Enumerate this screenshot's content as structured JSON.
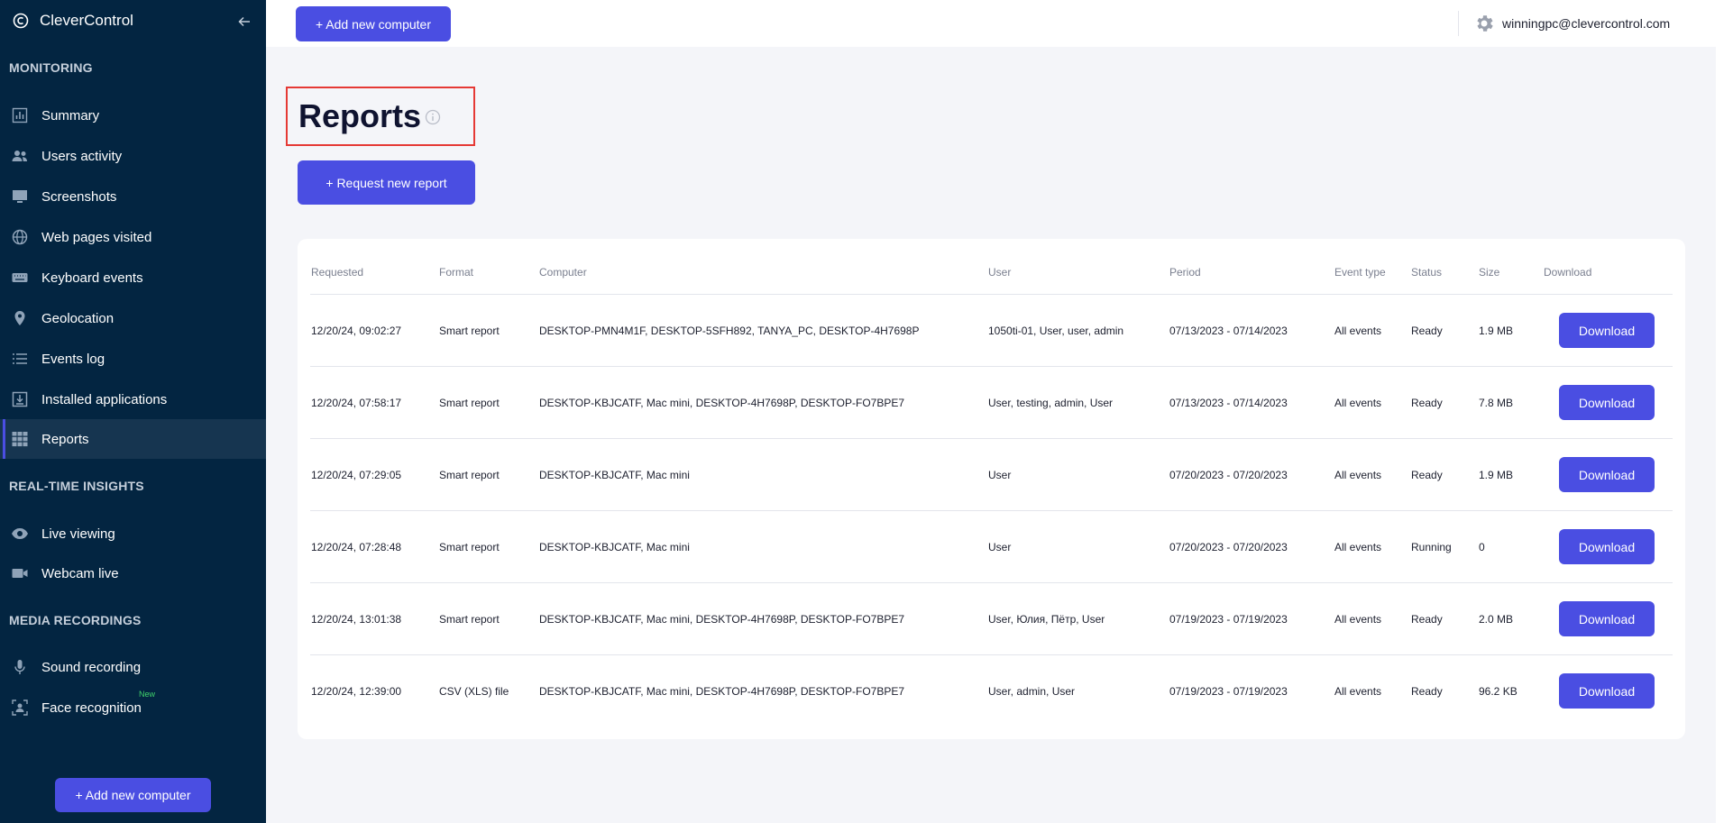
{
  "app": {
    "name": "CleverControl",
    "account_email": "winningpc@clevercontrol.com"
  },
  "sidebar": {
    "sections": {
      "monitoring": "MONITORING",
      "realtime": "REAL-TIME INSIGHTS",
      "media": "MEDIA RECORDINGS"
    },
    "items": [
      {
        "label": "Summary",
        "icon": "bar-chart-icon"
      },
      {
        "label": "Users activity",
        "icon": "users-icon"
      },
      {
        "label": "Screenshots",
        "icon": "monitor-icon"
      },
      {
        "label": "Web pages visited",
        "icon": "globe-icon"
      },
      {
        "label": "Keyboard events",
        "icon": "keyboard-icon"
      },
      {
        "label": "Geolocation",
        "icon": "map-pin-icon"
      },
      {
        "label": "Events log",
        "icon": "list-icon"
      },
      {
        "label": "Installed applications",
        "icon": "download-box-icon"
      },
      {
        "label": "Reports",
        "icon": "grid-icon",
        "active": true
      },
      {
        "label": "Live viewing",
        "icon": "eye-icon"
      },
      {
        "label": "Webcam live",
        "icon": "video-camera-icon"
      },
      {
        "label": "Sound recording",
        "icon": "microphone-icon"
      },
      {
        "label": "Face recognition",
        "icon": "face-scan-icon",
        "badge": "New"
      }
    ],
    "add_button": "+ Add new computer"
  },
  "topbar": {
    "add_button": "+ Add new computer"
  },
  "page": {
    "title": "Reports",
    "request_button": "+ Request new report"
  },
  "table": {
    "headers": [
      "Requested",
      "Format",
      "Computer",
      "User",
      "Period",
      "Event type",
      "Status",
      "Size",
      "Download"
    ],
    "download_label": "Download",
    "rows": [
      {
        "requested": "12/20/24, 09:02:27",
        "format": "Smart report",
        "computer": "DESKTOP-PMN4M1F, DESKTOP-5SFH892, TANYA_PC, DESKTOP-4H7698P",
        "user": "1050ti-01, User, user, admin",
        "period": "07/13/2023 - 07/14/2023",
        "event_type": "All events",
        "status": "Ready",
        "size": "1.9 MB"
      },
      {
        "requested": "12/20/24, 07:58:17",
        "format": "Smart report",
        "computer": "DESKTOP-KBJCATF, Mac mini, DESKTOP-4H7698P, DESKTOP-FO7BPE7",
        "user": "User, testing, admin, User",
        "period": "07/13/2023 - 07/14/2023",
        "event_type": "All events",
        "status": "Ready",
        "size": "7.8 MB"
      },
      {
        "requested": "12/20/24, 07:29:05",
        "format": "Smart report",
        "computer": "DESKTOP-KBJCATF, Mac mini",
        "user": "User",
        "period": "07/20/2023 - 07/20/2023",
        "event_type": "All events",
        "status": "Ready",
        "size": "1.9 MB"
      },
      {
        "requested": "12/20/24, 07:28:48",
        "format": "Smart report",
        "computer": "DESKTOP-KBJCATF, Mac mini",
        "user": "User",
        "period": "07/20/2023 - 07/20/2023",
        "event_type": "All events",
        "status": "Running",
        "size": "0"
      },
      {
        "requested": "12/20/24, 13:01:38",
        "format": "Smart report",
        "computer": "DESKTOP-KBJCATF, Mac mini, DESKTOP-4H7698P, DESKTOP-FO7BPE7",
        "user": "User, Юлия, Пётр, User",
        "period": "07/19/2023 - 07/19/2023",
        "event_type": "All events",
        "status": "Ready",
        "size": "2.0 MB"
      },
      {
        "requested": "12/20/24, 12:39:00",
        "format": "CSV (XLS) file",
        "computer": "DESKTOP-KBJCATF, Mac mini, DESKTOP-4H7698P, DESKTOP-FO7BPE7",
        "user": "User, admin, User",
        "period": "07/19/2023 - 07/19/2023",
        "event_type": "All events",
        "status": "Ready",
        "size": "96.2 KB"
      }
    ]
  },
  "colors": {
    "sidebar_bg": "#032541",
    "accent": "#4a4ee2",
    "highlight_border": "#e53935"
  }
}
